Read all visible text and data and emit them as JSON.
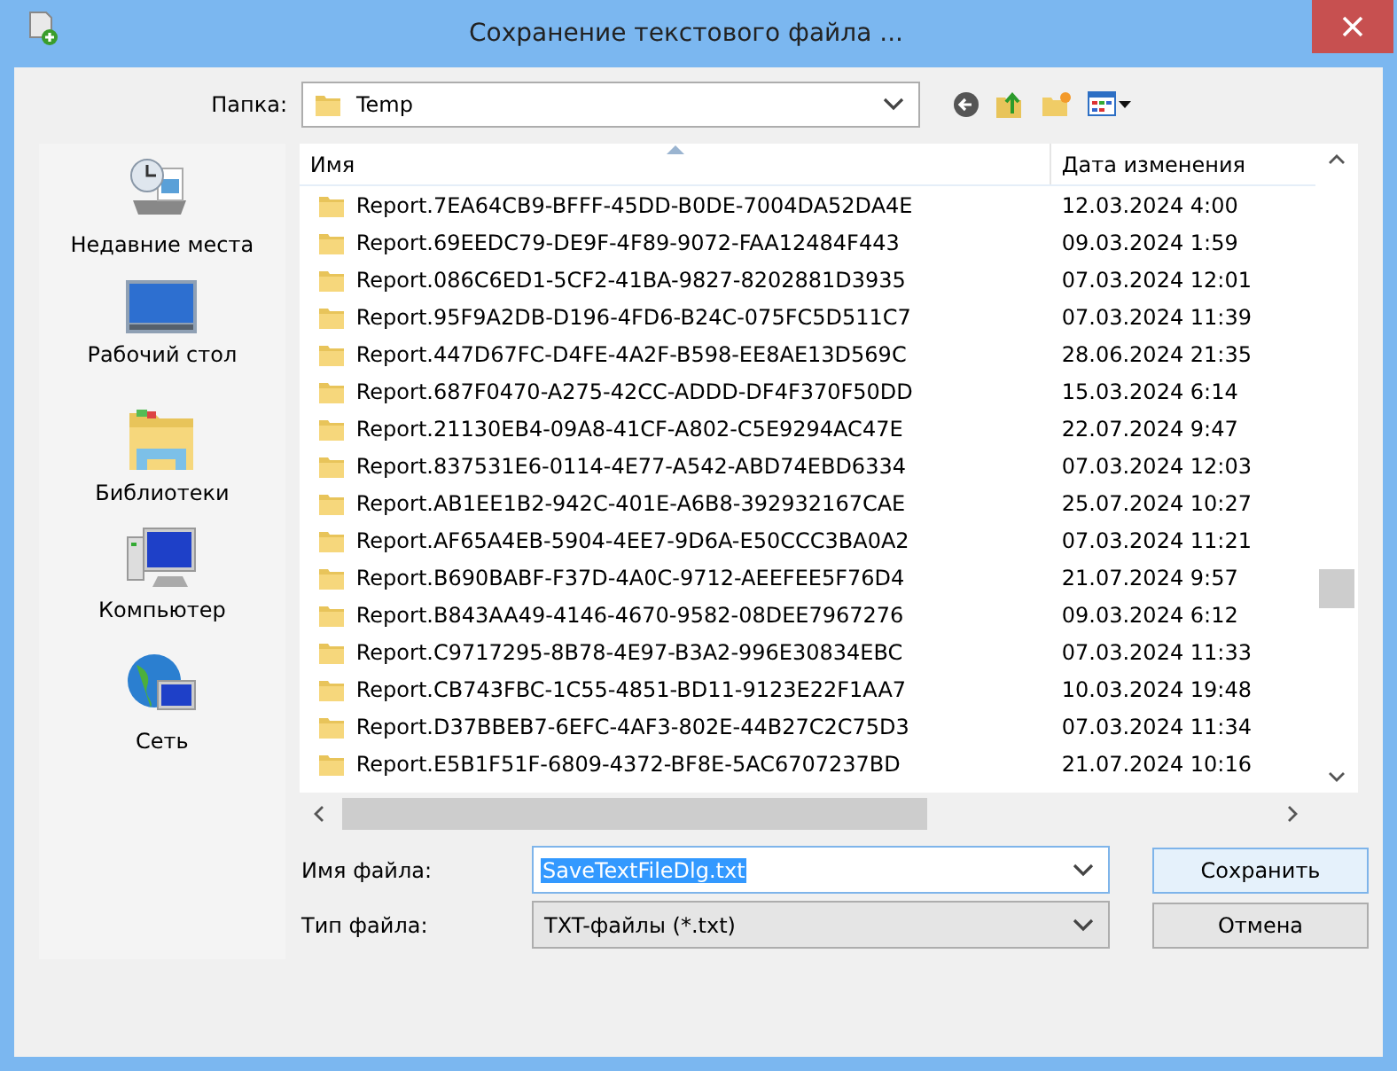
{
  "window": {
    "title": "Сохранение текстового файла ..."
  },
  "folder_bar": {
    "label": "Папка:",
    "value": "Temp"
  },
  "sidebar": {
    "items": [
      {
        "label": "Недавние места",
        "kind": "recent"
      },
      {
        "label": "Рабочий стол",
        "kind": "desktop"
      },
      {
        "label": "Библиотеки",
        "kind": "libraries"
      },
      {
        "label": "Компьютер",
        "kind": "computer"
      },
      {
        "label": "Сеть",
        "kind": "network"
      }
    ]
  },
  "file_list": {
    "columns": [
      {
        "label": "Имя",
        "sorted": true
      },
      {
        "label": "Дата изменения",
        "sorted": false
      }
    ],
    "rows": [
      {
        "name": "Report.7EA64CB9-BFFF-45DD-B0DE-7004DA52DA4E",
        "modified": "12.03.2024 4:00"
      },
      {
        "name": "Report.69EEDC79-DE9F-4F89-9072-FAA12484F443",
        "modified": "09.03.2024 1:59"
      },
      {
        "name": "Report.086C6ED1-5CF2-41BA-9827-8202881D3935",
        "modified": "07.03.2024 12:01"
      },
      {
        "name": "Report.95F9A2DB-D196-4FD6-B24C-075FC5D511C7",
        "modified": "07.03.2024 11:39"
      },
      {
        "name": "Report.447D67FC-D4FE-4A2F-B598-EE8AE13D569C",
        "modified": "28.06.2024 21:35"
      },
      {
        "name": "Report.687F0470-A275-42CC-ADDD-DF4F370F50DD",
        "modified": "15.03.2024 6:14"
      },
      {
        "name": "Report.21130EB4-09A8-41CF-A802-C5E9294AC47E",
        "modified": "22.07.2024 9:47"
      },
      {
        "name": "Report.837531E6-0114-4E77-A542-ABD74EBD6334",
        "modified": "07.03.2024 12:03"
      },
      {
        "name": "Report.AB1EE1B2-942C-401E-A6B8-392932167CAE",
        "modified": "25.07.2024 10:27"
      },
      {
        "name": "Report.AF65A4EB-5904-4EE7-9D6A-E50CCC3BA0A2",
        "modified": "07.03.2024 11:21"
      },
      {
        "name": "Report.B690BABF-F37D-4A0C-9712-AEEFEE5F76D4",
        "modified": "21.07.2024 9:57"
      },
      {
        "name": "Report.B843AA49-4146-4670-9582-08DEE7967276",
        "modified": "09.03.2024 6:12"
      },
      {
        "name": "Report.C9717295-8B78-4E97-B3A2-996E30834EBC",
        "modified": "07.03.2024 11:33"
      },
      {
        "name": "Report.CB743FBC-1C55-4851-BD11-9123E22F1AA7",
        "modified": "10.03.2024 19:48"
      },
      {
        "name": "Report.D37BBEB7-6EFC-4AF3-802E-44B27C2C75D3",
        "modified": "07.03.2024 11:34"
      },
      {
        "name": "Report.E5B1F51F-6809-4372-BF8E-5AC6707237BD",
        "modified": "21.07.2024 10:16"
      }
    ]
  },
  "file_name": {
    "label": "Имя файла:",
    "value": "SaveTextFileDlg.txt",
    "selected": true
  },
  "file_type": {
    "label": "Тип файла:",
    "value": "TXT-файлы (*.txt)"
  },
  "buttons": [
    {
      "label": "Сохранить",
      "default": true
    },
    {
      "label": "Отмена",
      "default": false
    }
  ]
}
